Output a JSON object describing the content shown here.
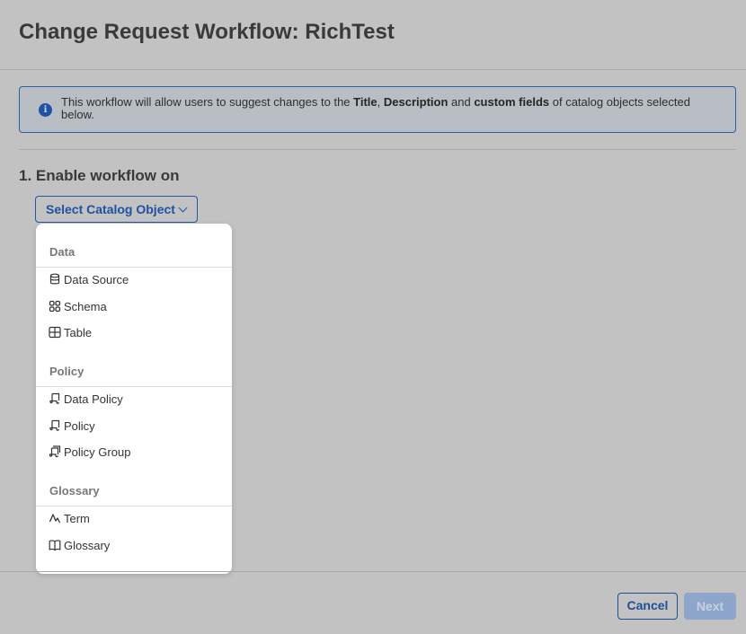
{
  "page": {
    "title": "Change Request Workflow: RichTest"
  },
  "banner": {
    "text_before": "This workflow will allow users to suggest changes to the ",
    "bold1": "Title",
    "comma": ", ",
    "bold2": "Description",
    "and": " and ",
    "bold3": "custom fields",
    "text_after": " of catalog objects selected below.",
    "icon": "info-icon"
  },
  "section": {
    "heading": "1. Enable workflow on"
  },
  "select": {
    "label": "Select Catalog Object",
    "icon": "chevron-down-icon"
  },
  "dropdown": {
    "groups": [
      {
        "label": "Data",
        "items": [
          {
            "label": "Data Source",
            "icon": "database-icon"
          },
          {
            "label": "Schema",
            "icon": "schema-icon"
          },
          {
            "label": "Table",
            "icon": "table-icon"
          }
        ]
      },
      {
        "label": "Policy",
        "items": [
          {
            "label": "Data Policy",
            "icon": "data-policy-icon"
          },
          {
            "label": "Policy",
            "icon": "policy-icon"
          },
          {
            "label": "Policy Group",
            "icon": "policy-group-icon"
          }
        ]
      },
      {
        "label": "Glossary",
        "items": [
          {
            "label": "Term",
            "icon": "term-icon"
          },
          {
            "label": "Glossary",
            "icon": "book-icon"
          }
        ]
      }
    ]
  },
  "footer": {
    "cancel_label": "Cancel",
    "next_label": "Next"
  },
  "colors": {
    "accent": "#1d52a5",
    "overlay_bg": "#c2c2c2",
    "next_disabled": "#8ea6cb"
  }
}
